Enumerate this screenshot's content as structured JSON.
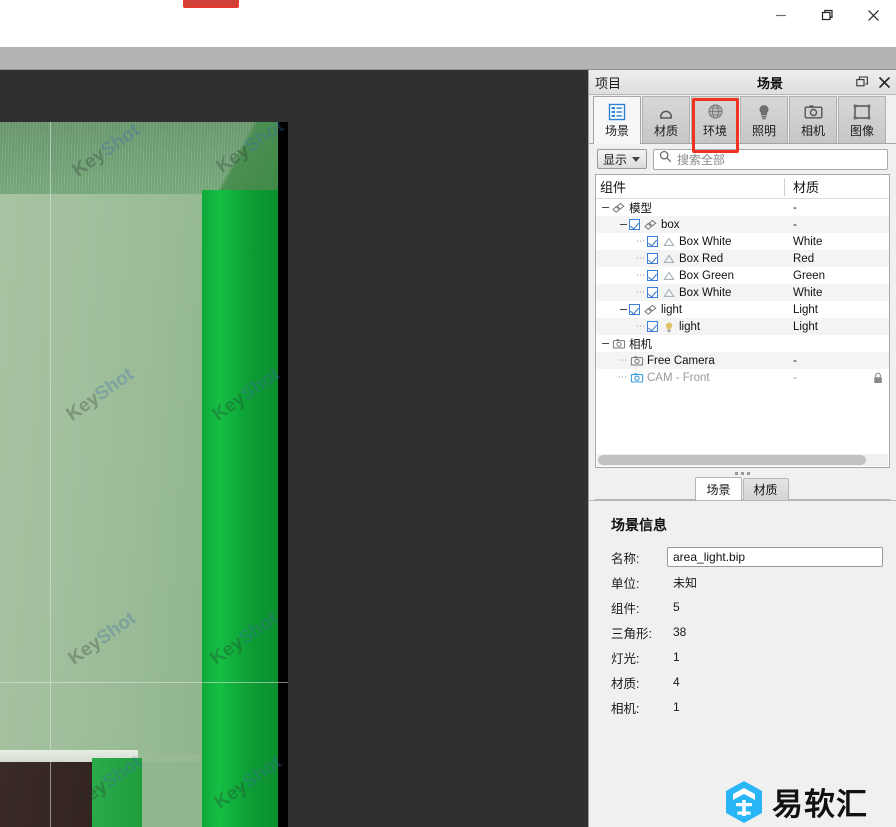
{
  "window": {
    "controls": [
      {
        "name": "minimize",
        "glyph": "minimize-icon"
      },
      {
        "name": "restore",
        "glyph": "restore-icon"
      },
      {
        "name": "close",
        "glyph": "close-icon"
      }
    ]
  },
  "viewport": {
    "watermark_text_1": "Key",
    "watermark_text_2": "Shot",
    "background_color": "#303030"
  },
  "panel": {
    "header": {
      "left_label": "项目",
      "title": "场景",
      "undock_icon": "undock-icon",
      "close_icon": "close-icon"
    },
    "tabs": [
      {
        "label": "场景",
        "icon": "scene-list-icon",
        "active": true
      },
      {
        "label": "材质",
        "icon": "material-sphere-icon",
        "active": false
      },
      {
        "label": "环境",
        "icon": "environment-globe-icon",
        "active": false
      },
      {
        "label": "照明",
        "icon": "lighting-bulb-icon",
        "active": false
      },
      {
        "label": "相机",
        "icon": "camera-icon",
        "active": false
      },
      {
        "label": "图像",
        "icon": "image-frame-icon",
        "active": false
      }
    ],
    "highlight_color": "#ee3322",
    "toolbar": {
      "show_button": "显示",
      "search_placeholder": "搜索全部",
      "search_value": "",
      "search_icon": "search-icon",
      "caret_icon": "chevron-down-icon"
    },
    "tree": {
      "columns": [
        "组件",
        "材质"
      ],
      "rows": [
        {
          "depth": 0,
          "twisty": "minus",
          "checkbox": null,
          "icon": "model-group-icon",
          "label": "模型",
          "material": "-",
          "alt": false,
          "dim": false,
          "locked": false
        },
        {
          "depth": 1,
          "twisty": "minus",
          "checkbox": true,
          "icon": "model-group-icon",
          "label": "box",
          "material": "-",
          "alt": true,
          "dim": false,
          "locked": false
        },
        {
          "depth": 2,
          "twisty": "dots",
          "checkbox": true,
          "icon": "triangle-mesh-icon",
          "label": "Box White",
          "material": "White",
          "alt": false,
          "dim": false,
          "locked": false
        },
        {
          "depth": 2,
          "twisty": "dots",
          "checkbox": true,
          "icon": "triangle-mesh-icon",
          "label": "Box Red",
          "material": "Red",
          "alt": true,
          "dim": false,
          "locked": false
        },
        {
          "depth": 2,
          "twisty": "dots",
          "checkbox": true,
          "icon": "triangle-mesh-icon",
          "label": "Box Green",
          "material": "Green",
          "alt": false,
          "dim": false,
          "locked": false
        },
        {
          "depth": 2,
          "twisty": "dots",
          "checkbox": true,
          "icon": "triangle-mesh-icon",
          "label": "Box White",
          "material": "White",
          "alt": true,
          "dim": false,
          "locked": false
        },
        {
          "depth": 1,
          "twisty": "minus",
          "checkbox": true,
          "icon": "model-group-icon",
          "label": "light",
          "material": "Light",
          "alt": false,
          "dim": false,
          "locked": false
        },
        {
          "depth": 2,
          "twisty": "dots",
          "checkbox": true,
          "icon": "light-bulb-icon",
          "label": "light",
          "material": "Light",
          "alt": true,
          "dim": false,
          "locked": false
        },
        {
          "depth": 0,
          "twisty": "minus",
          "checkbox": null,
          "icon": "camera-icon",
          "label": "相机",
          "material": "",
          "alt": false,
          "dim": false,
          "locked": false
        },
        {
          "depth": 1,
          "twisty": "dots",
          "checkbox": null,
          "icon": "camera-icon",
          "label": "Free Camera",
          "material": "-",
          "alt": true,
          "dim": false,
          "locked": false
        },
        {
          "depth": 1,
          "twisty": "dots",
          "checkbox": null,
          "icon": "camera-active-icon",
          "label": "CAM - Front",
          "material": "-",
          "alt": false,
          "dim": true,
          "locked": true
        }
      ]
    },
    "bottom_tabs": [
      {
        "label": "场景",
        "active": true
      },
      {
        "label": "材质",
        "active": false
      }
    ],
    "scene_info": {
      "title": "场景信息",
      "fields": [
        {
          "label": "名称:",
          "value": "area_light.bip",
          "type": "input"
        },
        {
          "label": "单位:",
          "value": "未知",
          "type": "text"
        },
        {
          "label": "组件:",
          "value": "5",
          "type": "text"
        },
        {
          "label": "三角形:",
          "value": "38",
          "type": "text"
        },
        {
          "label": "灯光:",
          "value": "1",
          "type": "text"
        },
        {
          "label": "材质:",
          "value": "4",
          "type": "text"
        },
        {
          "label": "相机:",
          "value": "1",
          "type": "text"
        }
      ]
    }
  },
  "brand": {
    "text": "易软汇",
    "logo_icon": "hexagon-logo-icon",
    "logo_color": "#29b6f6"
  }
}
